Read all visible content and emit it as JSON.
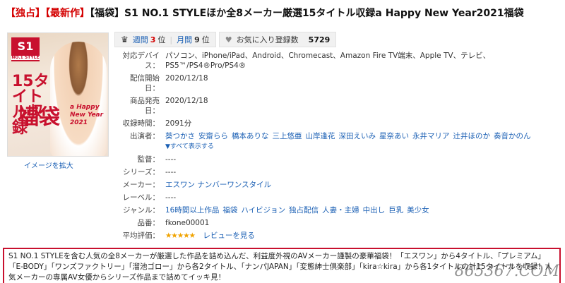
{
  "title": {
    "tag1": "【独占】",
    "tag2": "【最新作】",
    "text": "【福袋】S1 NO.1 STYLEほか全8メーカー厳選15タイトル収録a Happy New Year2021福袋"
  },
  "cover": {
    "logo": "S1",
    "logo_sub": "NO.1 STYLE",
    "big_text": "15タイトル収録",
    "kanji": "福袋",
    "hny": "a Happy New Year 2021",
    "enlarge_label": "イメージを拡大"
  },
  "stats": {
    "weekly_prefix": "週間",
    "weekly_rank": "3",
    "weekly_suffix": "位",
    "monthly_prefix": "月間",
    "monthly_rank": "9",
    "monthly_suffix": "位",
    "fav_label": "お気に入り登録数",
    "fav_count": "5729"
  },
  "info": {
    "devices_label": "対応デバイス：",
    "devices": "パソコン、iPhone/iPad、Android、Chromecast、Amazon Fire TV端末、Apple TV、テレビ、PS5™/PS4®Pro/PS4®",
    "release_label": "配信開始日：",
    "release": "2020/12/18",
    "sale_label": "商品発売日：",
    "sale": "2020/12/18",
    "duration_label": "収録時間：",
    "duration": "2091分",
    "cast_label": "出演者：",
    "cast": [
      "葵つかさ",
      "安齋らら",
      "橋本ありな",
      "三上悠亜",
      "山岸逢花",
      "深田えいみ",
      "星奈あい",
      "永井マリア",
      "辻井ほのか",
      "奏音かのん"
    ],
    "cast_more": "▼すべて表示する",
    "director_label": "監督：",
    "director": "----",
    "series_label": "シリーズ：",
    "series": "----",
    "maker_label": "メーカー：",
    "maker": "エスワン ナンバーワンスタイル",
    "label_label": "レーベル：",
    "label": "----",
    "genre_label": "ジャンル：",
    "genres": [
      "16時間以上作品",
      "福袋",
      "ハイビジョン",
      "独占配信",
      "人妻・主婦",
      "中出し",
      "巨乳",
      "美少女"
    ],
    "product_label": "品番：",
    "product": "fkone00001",
    "rating_label": "平均評価：",
    "stars": "★★★★★",
    "review_link": "レビューを見る"
  },
  "description": "S1 NO.1 STYLEを含む人気の全8メーカーが厳選した作品を詰め込んだ、利益度外視のAVメーカー謹製の豪華福袋！「エスワン」から4タイトル、「プレミアム」「E-BODY」「ワンズファクトリー」「溜池ゴロー」から各2タイトル、「ナンパJAPAN」「変態紳士倶楽部」「kira☆kira」から各1タイトルの計15タイトルを収録！人気メーカーの専属AV女優からシリーズ作品まで詰めてイッキ見！",
  "watermark": "865367.COM"
}
